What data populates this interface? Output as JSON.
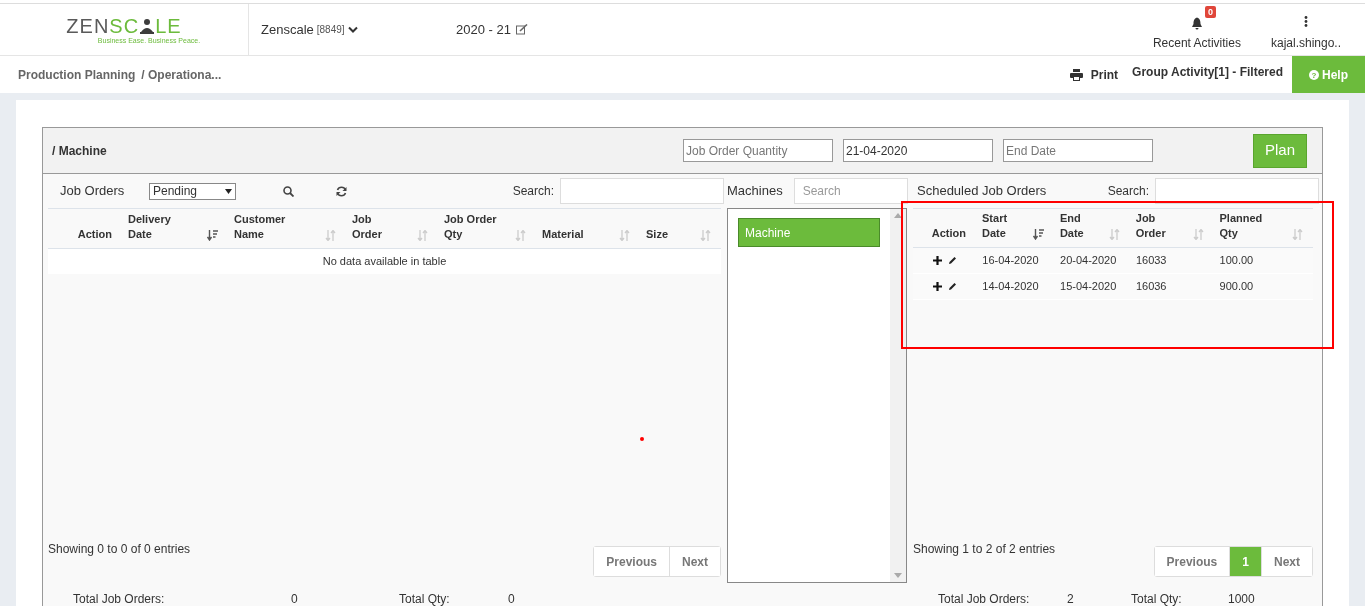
{
  "header": {
    "logo": {
      "text_before": "ZENSC",
      "text_after": "LE",
      "tagline": "Business Ease. Business Peace."
    },
    "company": "Zenscale",
    "company_code": "[8849]",
    "fiscal_year": "2020 - 21",
    "notifications": {
      "label": "Recent Activities",
      "count": "0"
    },
    "user": "kajal.shingo.."
  },
  "breadcrumb": [
    "Production Planning",
    "/ Operationa..."
  ],
  "actions": {
    "print": "Print",
    "group_activity": "Group Activity[1] - Filtered",
    "help_icon": "?",
    "help": "Help"
  },
  "toolbar": {
    "title": "/ Machine",
    "fields": [
      {
        "placeholder": "Job Order Quantity"
      },
      {
        "value": "21-04-2020"
      },
      {
        "placeholder": "End Date"
      }
    ],
    "plan_button": "Plan"
  },
  "job_orders": {
    "title": "Job Orders",
    "filter": "Pending",
    "search_label": "Search:",
    "columns": [
      {
        "label": "Action",
        "sortable": false
      },
      {
        "label": "Delivery\nDate",
        "sortable": true,
        "sorted": true
      },
      {
        "label": "Customer\nName",
        "sortable": true,
        "sorted": false
      },
      {
        "label": "Job\nOrder",
        "sortable": true,
        "sorted": false
      },
      {
        "label": "Job Order\nQty",
        "sortable": true,
        "sorted": false
      },
      {
        "label": "Material",
        "sortable": true,
        "sorted": false
      },
      {
        "label": "Size",
        "sortable": true,
        "sorted": false
      }
    ],
    "empty_message": "No data available in table",
    "info": "Showing 0 to 0 of 0 entries",
    "pagination": [
      {
        "label": "Previous",
        "selected": false
      },
      {
        "label": "Next",
        "selected": false
      }
    ],
    "totals": [
      {
        "label": "Total Job Orders:",
        "value": "0"
      },
      {
        "label": "Total Qty:",
        "value": "0"
      }
    ]
  },
  "machines": {
    "title": "Machines",
    "search_placeholder": "Search",
    "items": [
      {
        "label": "Machine",
        "selected": true
      }
    ]
  },
  "scheduled": {
    "title": "Scheduled Job Orders",
    "search_label": "Search:",
    "columns": [
      {
        "label": "Action",
        "sortable": false
      },
      {
        "label": "Start\nDate",
        "sortable": true,
        "sorted": true
      },
      {
        "label": "End\nDate",
        "sortable": true,
        "sorted": false
      },
      {
        "label": "Job\nOrder",
        "sortable": true,
        "sorted": false
      },
      {
        "label": "Planned\nQty",
        "sortable": true,
        "sorted": false
      }
    ],
    "rows": [
      {
        "cells": [
          "",
          "16-04-2020",
          "20-04-2020",
          "16033",
          "100.00"
        ]
      },
      {
        "cells": [
          "",
          "14-04-2020",
          "15-04-2020",
          "16036",
          "900.00"
        ]
      }
    ],
    "info": "Showing 1 to 2 of 2 entries",
    "pagination": [
      {
        "label": "Previous",
        "selected": false
      },
      {
        "label": "1",
        "selected": true
      },
      {
        "label": "Next",
        "selected": false
      }
    ],
    "totals": [
      {
        "label": "Total Job Orders:",
        "value": "2"
      },
      {
        "label": "Total Qty:",
        "value": "1000"
      }
    ]
  }
}
